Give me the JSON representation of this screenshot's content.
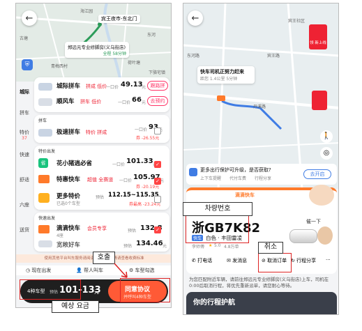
{
  "left": {
    "map": {
      "place1": "海江园",
      "place2": "东河",
      "place3": "古塘",
      "place4": "青梅西村",
      "place5": "荷叶塘",
      "place6": "下骆宅镇",
      "dest_label": "宾王夜市-东北门",
      "origin_label": "郑远元专业修脚房(义乌街店)",
      "origin_eta": "全程 58分钟"
    },
    "sidebar": [
      {
        "label": "城际"
      },
      {
        "label": "拼车"
      },
      {
        "label": "特价",
        "badge": "37"
      },
      {
        "label": "快速"
      },
      {
        "label": "舒适"
      },
      {
        "label": "六座"
      },
      {
        "label": "送货"
      }
    ],
    "rows": [
      {
        "name": "城际拼车",
        "tag": "拼成 低价",
        "price_prefix": "一口价",
        "price": "49.13",
        "unit": "元",
        "action": "跟路拼"
      },
      {
        "name": "顺风车",
        "tag": "拼车 低价",
        "price_prefix": "一口价",
        "price": "66",
        "unit": "元",
        "action": "去预约"
      }
    ],
    "section_pinche": "拼车",
    "express": {
      "name": "极速拼车",
      "tag": "特价 拼成",
      "price_prefix": "一口价",
      "price": "93",
      "unit": "元",
      "discount": "券 -26.55元"
    },
    "section_tejia": "特价出发",
    "tejia_rows": [
      {
        "name": "花小猪逍必省",
        "price_prefix": "一口价",
        "price": "101.33",
        "unit": "元"
      },
      {
        "name": "特惠快车",
        "tag": "超值 全赛道",
        "price_prefix": "一口价",
        "price": "105.97",
        "unit": "元",
        "discount": "券 -20.19元"
      },
      {
        "name": "更多特价",
        "sub": "已选0个车型",
        "price_prefix": "预估",
        "price": "112.15~115.35",
        "unit": "元",
        "discount": "券最高 -23.24元"
      }
    ],
    "section_kuaisu": "快速出发",
    "kuaisu_rows": [
      {
        "name": "滴滴快车",
        "tag": "会员专享",
        "sub": "4座",
        "price_prefix": "预估",
        "price": "132.8",
        "unit": "元"
      },
      {
        "name": "宽敞好车",
        "price_prefix": "预估",
        "price": "134.46",
        "unit": "元"
      }
    ],
    "notice": "使用其他平台叫车服务请阅读并同意，详情请查看收费标准",
    "options": {
      "now": "现在出发",
      "for_others": "帮人叫车",
      "car_select": "车型勾选"
    },
    "footer": {
      "count_label": "4种车型",
      "estimate_prefix": "预估",
      "estimate": "101-133",
      "unit": "元",
      "agree_button": "同意协议",
      "agree_sub": "并呼叫4种车型"
    },
    "korean_call": "호출",
    "korean_fare": "예상 요금"
  },
  "right": {
    "map": {
      "road1": "宾王路",
      "road2": "丹溪路",
      "road3": "东河路",
      "place1": "宾王社区",
      "status": "快车司机正努力赶来",
      "status_sub": "距您 1.4公里 5分钟",
      "promo_badge": "领 新上线"
    },
    "upgrade_banner": {
      "title": "更多出行保护可升级，是否获取?",
      "opt1": "上下车提醒",
      "opt2": "代付车费",
      "opt3": "行程分享",
      "button": "去开启"
    },
    "driver_card": {
      "brand_label": "滴滴快车",
      "plate": "浙GB7K82",
      "car_tag": "快车",
      "car_desc": "白色 · 丰田雷凌",
      "driver": "李师傅",
      "rating": "5.0",
      "orders": "4.8万单",
      "report": "催一下"
    },
    "actions": {
      "call": "打电话",
      "message": "发消息",
      "cancel": "取消订单",
      "share": "行程分享",
      "more": "···"
    },
    "notice": "为您匹配附近车辆，请前往郑远元专业修脚房(义乌街店)上车，司机在0:00后取消行程，将优先重新派单，请您耐心等待。",
    "bottom_title": "你的行程护航",
    "korean_plate": "차량번호",
    "korean_cancel": "취소"
  },
  "colors": {
    "accent": "#ff5a36",
    "didi_orange": "#ff7a2a",
    "blue": "#3f7ce4",
    "red_box": "#d22222"
  }
}
